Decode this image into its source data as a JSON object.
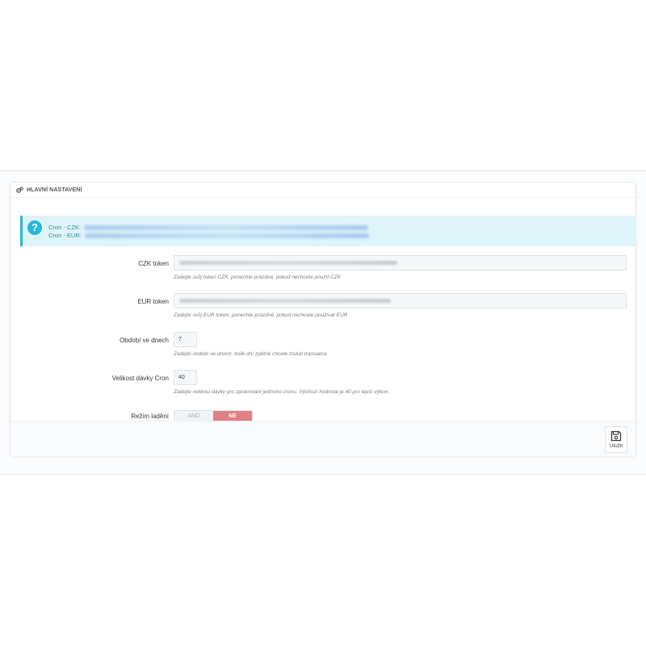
{
  "panel": {
    "title": "HLAVNÍ NASTAVENÍ",
    "title_icon": "cogs-icon"
  },
  "alert": {
    "icon": "question-circle-icon",
    "lines": [
      {
        "label": "Cron - CZK:"
      },
      {
        "label": "Cron - EUR:"
      }
    ]
  },
  "form": {
    "czk_token": {
      "label": "CZK token",
      "help": "Zadejte svůj token CZK, ponechte prázdné, pokud nechcete použít CZK"
    },
    "eur_token": {
      "label": "EUR token",
      "help": "Zadejte svůj EUR token, ponechte prázdné, pokud nechcete používat EUR"
    },
    "period": {
      "label": "Období ve dnech",
      "value": "7",
      "help": "Zadejte období ve dnech, kolik dní zpětně chcete získat transakce"
    },
    "batch": {
      "label": "Velikost dávky Cron",
      "value": "40",
      "help": "Zadejte velikost dávky pro zpracování jednoho cronu. Výchozí hodnota je 40 pro lepší výkon."
    },
    "debug": {
      "label": "Režim ladění",
      "yes": "ANO",
      "no": "NE",
      "selected": "NE"
    }
  },
  "footer": {
    "save_label": "Uložit",
    "save_icon": "save-icon"
  },
  "colors": {
    "accent": "#25b9d7",
    "switch_active": "#e08087",
    "alert_bg": "#dff4f9"
  }
}
